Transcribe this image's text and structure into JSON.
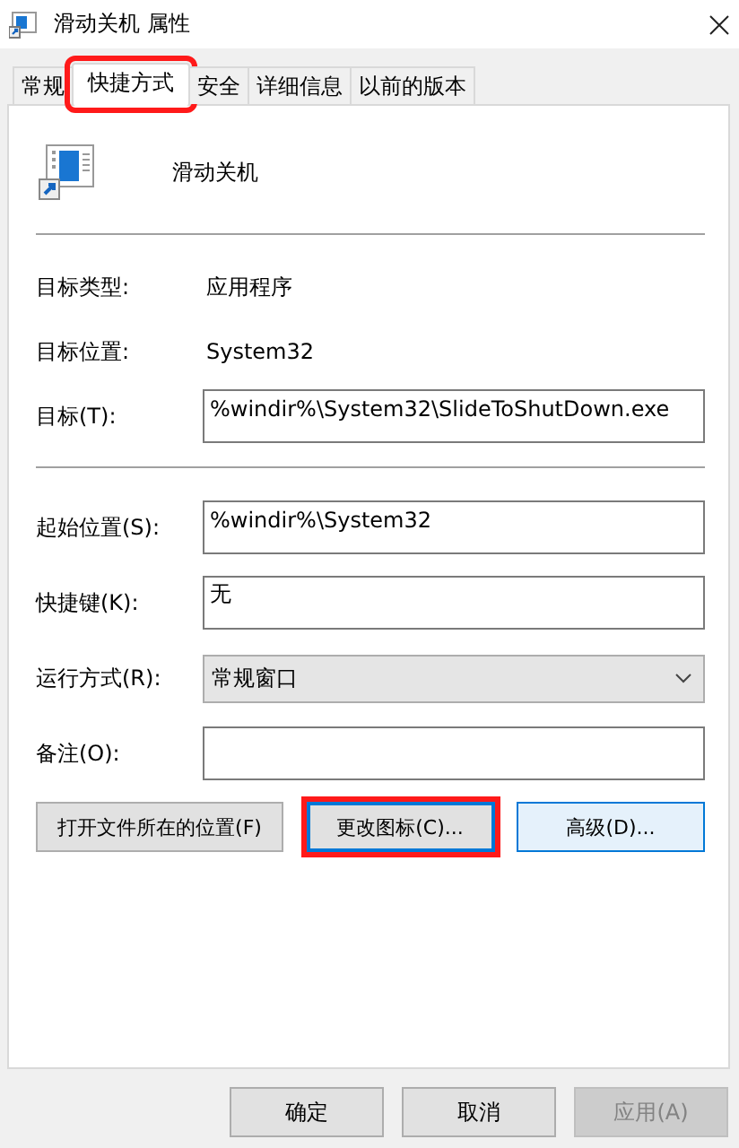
{
  "window": {
    "title": "滑动关机 属性"
  },
  "tabs": [
    {
      "label": "常规",
      "selected": false,
      "highlighted": false
    },
    {
      "label": "快捷方式",
      "selected": true,
      "highlighted": true
    },
    {
      "label": "安全",
      "selected": false,
      "highlighted": false
    },
    {
      "label": "详细信息",
      "selected": false,
      "highlighted": false
    },
    {
      "label": "以前的版本",
      "selected": false,
      "highlighted": false
    }
  ],
  "shortcut_name": "滑动关机",
  "info": [
    {
      "label": "目标类型:",
      "value": "应用程序"
    },
    {
      "label": "目标位置:",
      "value": "System32"
    }
  ],
  "target": {
    "label": "目标(T):",
    "value": "%windir%\\System32\\SlideToShutDown.exe"
  },
  "fields": [
    {
      "kind": "text",
      "label": "起始位置(S):",
      "value": "%windir%\\System32"
    },
    {
      "kind": "text",
      "label": "快捷键(K):",
      "value": "无"
    },
    {
      "kind": "select",
      "label": "运行方式(R):",
      "value": "常规窗口"
    },
    {
      "kind": "text",
      "label": "备注(O):"
    }
  ],
  "actions": [
    {
      "label": "打开文件所在的位置(F)",
      "focused": false,
      "default": false,
      "highlighted": false
    },
    {
      "label": "更改图标(C)...",
      "focused": true,
      "default": false,
      "highlighted": true
    },
    {
      "label": "高级(D)...",
      "focused": false,
      "default": true,
      "highlighted": false
    }
  ],
  "buttons": [
    {
      "label": "确定",
      "disabled": false
    },
    {
      "label": "取消",
      "disabled": false
    },
    {
      "label": "应用(A)",
      "disabled": true
    }
  ]
}
